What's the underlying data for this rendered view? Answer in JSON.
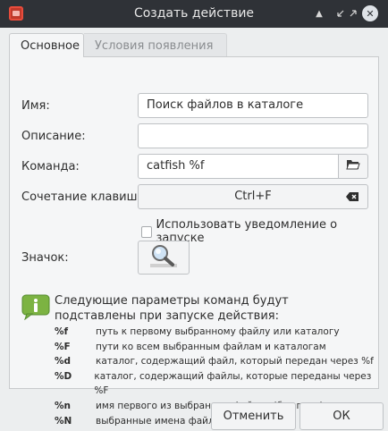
{
  "window": {
    "title": "Создать действие"
  },
  "tabs": [
    {
      "label": "Основное"
    },
    {
      "label": "Условия появления"
    }
  ],
  "form": {
    "name_label": "Имя:",
    "name_value": "Поиск файлов в каталоге",
    "description_label": "Описание:",
    "description_value": "",
    "command_label": "Команда:",
    "command_value": "catfish %f",
    "shortcut_label": "Сочетание клавиш",
    "shortcut_value": "Ctrl+F",
    "notify_checkbox_label": "Использовать уведомление о запуске",
    "notify_checked": false,
    "icon_label": "Значок:"
  },
  "info": {
    "text": "Следующие параметры команд будут подставлены при запуске действия:",
    "params": [
      {
        "code": "%f",
        "desc": "путь к первому выбранному файлу или каталогу"
      },
      {
        "code": "%F",
        "desc": "пути ко всем выбранным файлам и каталогам"
      },
      {
        "code": "%d",
        "desc": "каталог, содержащий файл, который передан через %f"
      },
      {
        "code": "%D",
        "desc": "каталог, содержащий файлы, которые переданы через %F"
      },
      {
        "code": "%n",
        "desc": "имя первого из выбранных файлов (без пути)"
      },
      {
        "code": "%N",
        "desc": "выбранные имена файлов (без пути)"
      }
    ]
  },
  "buttons": {
    "cancel": "Отменить",
    "ok": "ОК"
  },
  "colors": {
    "titlebar": "#2f3237",
    "dialog_bg": "#eceeef",
    "info_icon": "#7cb342"
  }
}
